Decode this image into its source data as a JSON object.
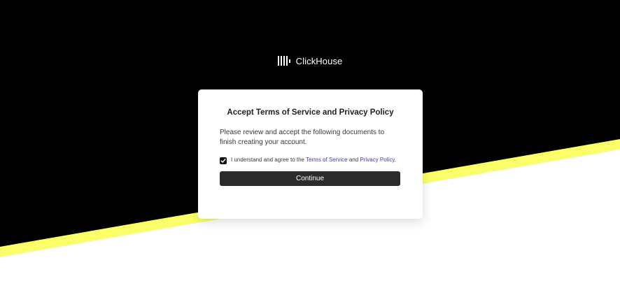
{
  "brand": {
    "name": "ClickHouse",
    "icon": "clickhouse-logo-icon"
  },
  "card": {
    "title": "Accept Terms of Service and Privacy Policy",
    "description": "Please review and accept the following documents to finish creating your account.",
    "consent": {
      "checked": true,
      "prefix": "I understand and agree to the ",
      "terms_link": "Terms of Service",
      "conjunction": " and ",
      "privacy_link": "Privacy Policy",
      "suffix": "."
    },
    "continue_label": "Continue"
  },
  "colors": {
    "background_dark": "#000000",
    "accent_stripe": "#faff69",
    "link": "#3d3db8",
    "button": "#2b2b2e"
  }
}
